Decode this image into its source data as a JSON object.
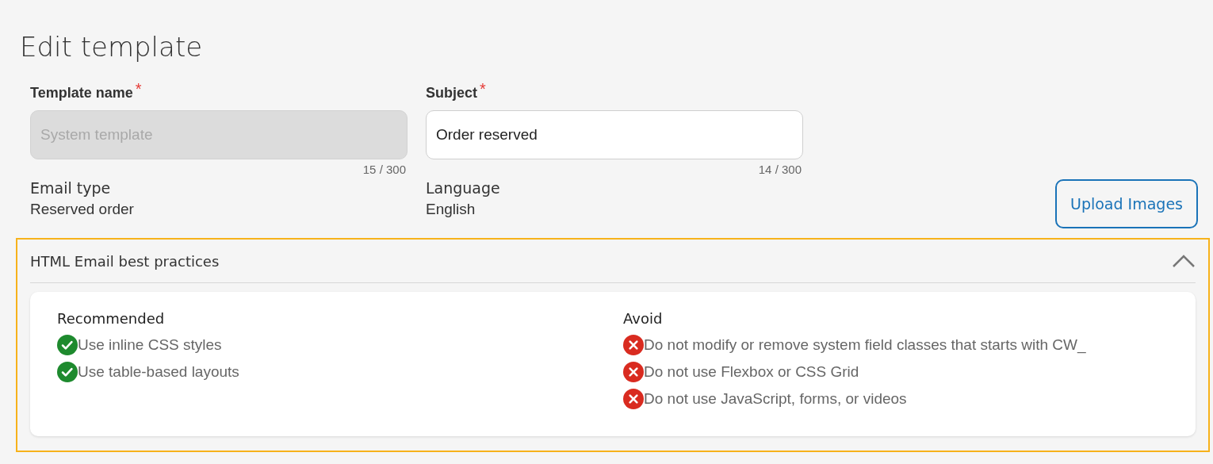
{
  "page_title": "Edit template",
  "fields": [
    {
      "label": "Template name",
      "required_mark": "*",
      "placeholder": "System template",
      "disabled": true,
      "counter": "15 / 300"
    },
    {
      "label": "Subject",
      "required_mark": "*",
      "value": "Order reserved",
      "disabled": false,
      "counter": "14 / 300"
    }
  ],
  "info": [
    {
      "label": "Email type",
      "value": "Reserved order"
    },
    {
      "label": "Language",
      "value": "English"
    }
  ],
  "upload_button": "Upload Images",
  "accordion": {
    "title": "HTML Email best practices",
    "expanded": true,
    "columns": [
      {
        "heading": "Recommended",
        "kind": "do",
        "items": [
          "Use inline CSS styles",
          "Use table-based layouts"
        ]
      },
      {
        "heading": "Avoid",
        "kind": "dont",
        "items": [
          "Do not modify or remove system field classes that starts with CW_",
          "Do not use Flexbox or CSS Grid",
          "Do not use JavaScript, forms, or videos"
        ]
      }
    ]
  }
}
